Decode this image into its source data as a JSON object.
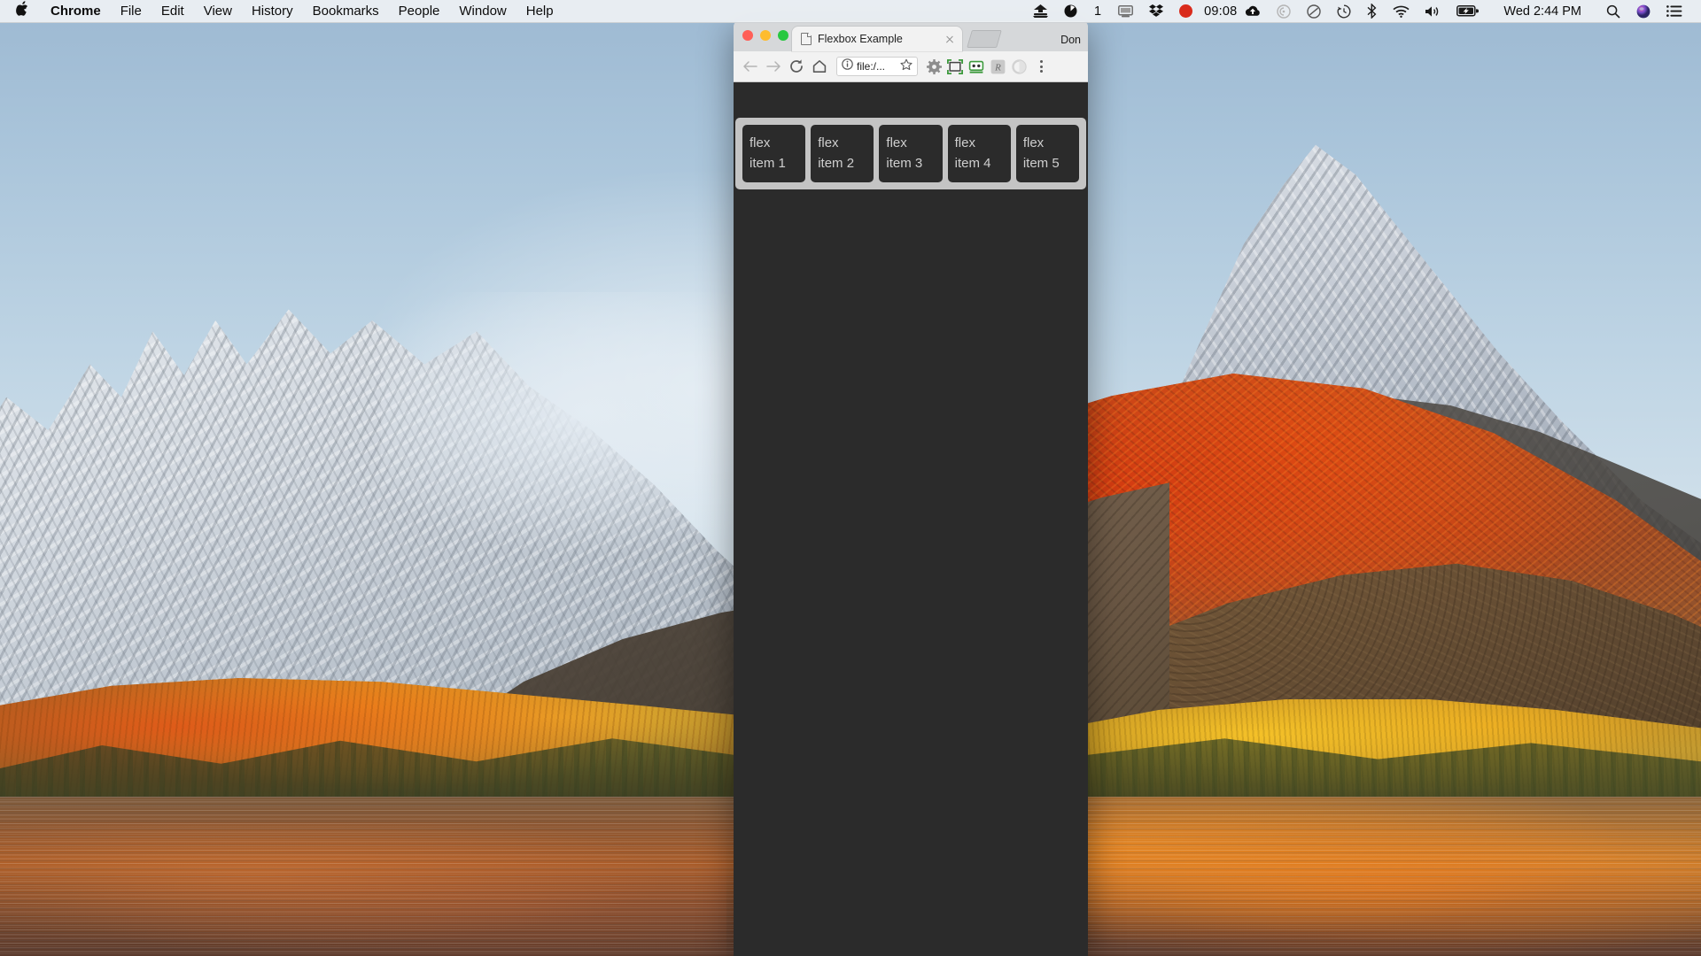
{
  "menubar": {
    "apple_glyph": "",
    "items": [
      {
        "label": "Chrome",
        "bold": true
      },
      {
        "label": "File",
        "bold": false
      },
      {
        "label": "Edit",
        "bold": false
      },
      {
        "label": "View",
        "bold": false
      },
      {
        "label": "History",
        "bold": false
      },
      {
        "label": "Bookmarks",
        "bold": false
      },
      {
        "label": "People",
        "bold": false
      },
      {
        "label": "Window",
        "bold": false
      },
      {
        "label": "Help",
        "bold": false
      }
    ],
    "status": {
      "display_count": "1",
      "recording_time": "09:08",
      "clock": "Wed 2:44 PM",
      "icons": [
        "scanner-icon",
        "dark-clock-icon",
        "display-icon",
        "dropbox-icon",
        "record-dot-icon",
        "cloud-upload-icon",
        "airdrop-icon",
        "do-not-disturb-icon",
        "time-machine-icon",
        "bluetooth-icon",
        "wifi-icon",
        "volume-icon",
        "battery-charging-icon",
        "spotlight-search-icon",
        "siri-icon",
        "control-center-icon"
      ]
    }
  },
  "browser": {
    "traffic_lights": [
      "close",
      "minimize",
      "zoom"
    ],
    "tab": {
      "title": "Flexbox Example",
      "favicon": "document-icon",
      "close_label": "×"
    },
    "new_tab_label": "+",
    "profile_name": "Don",
    "toolbar": {
      "back_icon": "back-arrow-icon",
      "forward_icon": "forward-arrow-icon",
      "reload_icon": "reload-icon",
      "home_icon": "home-icon",
      "url": "file:/...",
      "info_icon": "info-circle-icon",
      "bookmark_icon": "star-icon",
      "extensions": [
        {
          "name": "gear-extension-icon",
          "color": "#8d8d8d"
        },
        {
          "name": "screenshot-frame-extension-icon",
          "color": "#3d9a3d"
        },
        {
          "name": "robot-extension-icon",
          "color": "#3d9a3d"
        },
        {
          "name": "r-badge-extension-icon",
          "color": "#9a9a9a"
        },
        {
          "name": "circle-extension-icon",
          "color": "#cfcfcf"
        }
      ],
      "menu_icon": "three-dot-menu-icon"
    }
  },
  "page": {
    "background_color": "#2b2b2b",
    "container_color": "#c4c4c4",
    "item_color": "#2b2b2b",
    "item_text_color": "#cfcfcf",
    "flex_items": [
      {
        "label": "flex item 1"
      },
      {
        "label": "flex item 2"
      },
      {
        "label": "flex item 3"
      },
      {
        "label": "flex item 4"
      },
      {
        "label": "flex item 5"
      }
    ]
  },
  "desktop": {
    "wallpaper_name": "macos-high-sierra-mountain-lake",
    "sky_color": "#a9c4da",
    "snow_color": "#dfe4ea",
    "autumn_color": "#d63a10",
    "water_color": "#a85c28"
  }
}
